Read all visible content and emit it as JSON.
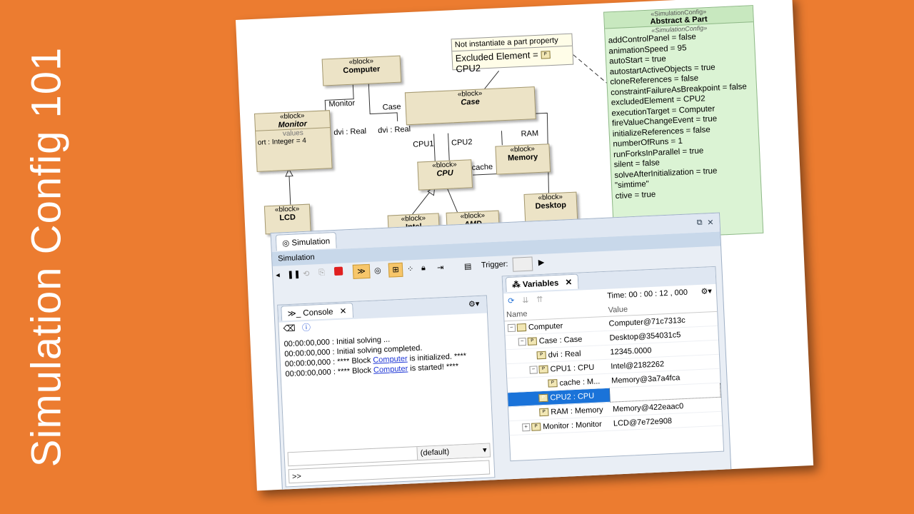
{
  "slide_title": "Simulation Config 101",
  "diagram": {
    "blocks": {
      "computer": {
        "stereo": "«block»",
        "name": "Computer"
      },
      "monitor": {
        "stereo": "«block»",
        "name": "Monitor",
        "section": "values",
        "value": "ort : Integer = 4"
      },
      "case": {
        "stereo": "«block»",
        "name": "Case"
      },
      "cpu": {
        "stereo": "«block»",
        "name": "CPU"
      },
      "memory": {
        "stereo": "«block»",
        "name": "Memory"
      },
      "lcd": {
        "stereo": "«block»",
        "name": "LCD"
      },
      "intel": {
        "stereo": "«block»",
        "name": "Intel"
      },
      "amd": {
        "stereo": "«block»",
        "name": "AMD"
      },
      "desktop": {
        "stereo": "«block»",
        "name": "Desktop"
      }
    },
    "labels": {
      "monitor": "Monitor",
      "case": "Case",
      "dvi_real_1": "dvi : Real",
      "dvi_real_2": "dvi : Real",
      "cpu1": "CPU1",
      "cpu2": "CPU2",
      "ram": "RAM",
      "cache": "cache"
    },
    "note": {
      "line1": "Not instantiate a part property",
      "line2": "Excluded Element = ",
      "line2_value": "CPU2"
    }
  },
  "config": {
    "stereo": "«SimulationConfig»",
    "name": "Abstract & Part",
    "section": "«SimulationConfig»",
    "rows": [
      "addControlPanel = false",
      "animationSpeed = 95",
      "autoStart = true",
      "autostartActiveObjects = true",
      "cloneReferences = false",
      "constraintFailureAsBreakpoint = false",
      "excludedElement = CPU2",
      "executionTarget = Computer",
      "fireValueChangeEvent = true",
      "initializeReferences = false",
      "numberOfRuns = 1",
      "runForksInParallel = true",
      "silent = false",
      "solveAfterInitialization = true",
      "",
      "\"simtime\"",
      "ctive = true"
    ]
  },
  "sim": {
    "tab_label": "Simulation",
    "title_bar": "Simulation",
    "trigger_label": "Trigger:",
    "console": {
      "tab_label": "Console",
      "lines": [
        {
          "pre": "00:00:00,000 : Initial solving ...",
          "link": "",
          "post": ""
        },
        {
          "pre": "00:00:00,000 : Initial solving completed.",
          "link": "",
          "post": ""
        },
        {
          "pre": "00:00:00,000 : **** Block ",
          "link": "Computer",
          "post": " is initialized. ****"
        },
        {
          "pre": "00:00:00,000 : **** Block ",
          "link": "Computer",
          "post": " is started! ****"
        }
      ],
      "combo_value": "(default)",
      "prompt": ">>"
    },
    "variables": {
      "tab_label": "Variables",
      "time_label": "Time: 00 : 00 : 12 , 000",
      "col_name": "Name",
      "col_value": "Value",
      "rows": [
        {
          "name": "Computer",
          "value": "Computer@71c7313c",
          "level": 0,
          "toggle": "−",
          "selected": false
        },
        {
          "name": "Case : Case",
          "value": "Desktop@354031c5",
          "level": 1,
          "toggle": "−",
          "selected": false
        },
        {
          "name": "dvi : Real",
          "value": "12345.0000",
          "level": 2,
          "toggle": "",
          "selected": false
        },
        {
          "name": "CPU1 : CPU",
          "value": "Intel@2182262",
          "level": 2,
          "toggle": "−",
          "selected": false
        },
        {
          "name": "cache : M...",
          "value": "Memory@3a7a4fca",
          "level": 3,
          "toggle": "",
          "selected": false
        },
        {
          "name": "CPU2 : CPU",
          "value": "",
          "level": 2,
          "toggle": "",
          "selected": true
        },
        {
          "name": "RAM : Memory",
          "value": "Memory@422eaac0",
          "level": 2,
          "toggle": "",
          "selected": false
        },
        {
          "name": "Monitor : Monitor",
          "value": "LCD@7e72e908",
          "level": 1,
          "toggle": "+",
          "selected": false
        }
      ]
    }
  }
}
